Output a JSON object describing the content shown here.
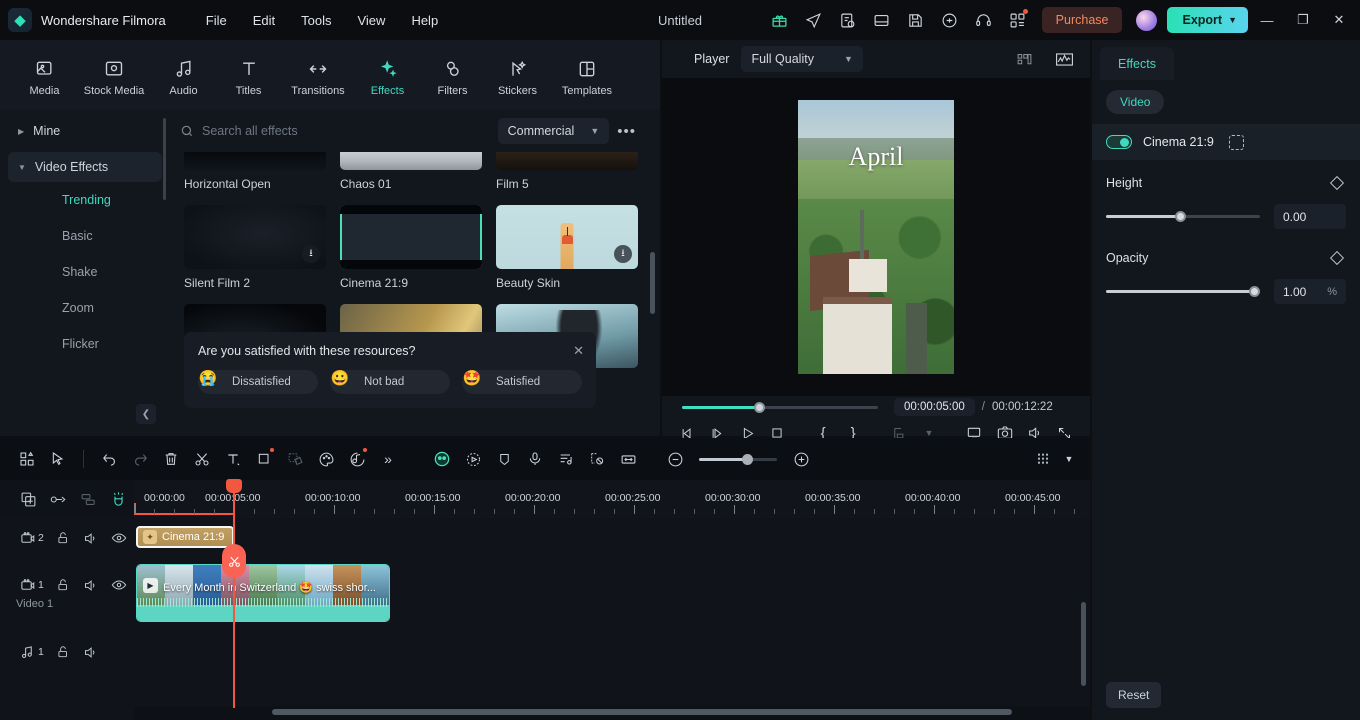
{
  "titlebar": {
    "brand": "Wondershare Filmora",
    "menus": [
      "File",
      "Edit",
      "Tools",
      "View",
      "Help"
    ],
    "doc_title": "Untitled",
    "icons": [
      "gift-icon",
      "send-icon",
      "tasklist-icon",
      "layout-icon",
      "save-icon",
      "cloud-icon",
      "headset-icon",
      "apps-icon"
    ],
    "purchase_label": "Purchase",
    "export_label": "Export",
    "accent_color": "#2ae0b4",
    "purchase_color": "#f0895f"
  },
  "modebar": {
    "items": [
      {
        "label": "Media",
        "icon": "media-icon"
      },
      {
        "label": "Stock Media",
        "icon": "stock-media-icon"
      },
      {
        "label": "Audio",
        "icon": "audio-icon"
      },
      {
        "label": "Titles",
        "icon": "titles-icon"
      },
      {
        "label": "Transitions",
        "icon": "transitions-icon"
      },
      {
        "label": "Effects",
        "icon": "effects-icon"
      },
      {
        "label": "Filters",
        "icon": "filters-icon"
      },
      {
        "label": "Stickers",
        "icon": "stickers-icon"
      },
      {
        "label": "Templates",
        "icon": "templates-icon"
      }
    ],
    "active": "Effects"
  },
  "search": {
    "placeholder": "Search all effects",
    "filter_label": "Commercial",
    "more_label": "•••"
  },
  "categories": {
    "mine": "Mine",
    "group": "Video Effects",
    "items": [
      "Trending",
      "Basic",
      "Shake",
      "Zoom",
      "Flicker"
    ],
    "active": "Trending"
  },
  "effects_grid": {
    "row_top": [
      "Horizontal Open",
      "Chaos 01",
      "Film 5"
    ],
    "row_main": [
      {
        "label": "Silent Film 2",
        "download": true,
        "selected": false
      },
      {
        "label": "Cinema 21:9",
        "download": false,
        "selected": true
      },
      {
        "label": "Beauty Skin",
        "download": true,
        "selected": false
      }
    ]
  },
  "feedback": {
    "question": "Are you satisfied with these resources?",
    "options": [
      {
        "label": "Dissatisfied",
        "emoji": "😭"
      },
      {
        "label": "Not bad",
        "emoji": "😀"
      },
      {
        "label": "Satisfied",
        "emoji": "🤩"
      }
    ]
  },
  "player": {
    "label": "Player",
    "quality": "Full Quality",
    "overlay_text": "April",
    "current_time": "00:00:05:00",
    "separator": "/",
    "total_time": "00:00:12:22",
    "controls": [
      "prev-frame-icon",
      "next-frame-icon",
      "play-icon",
      "stop-icon",
      "mark-in-icon",
      "mark-out-icon",
      "marker-icon",
      "chevron-down-icon",
      "screen-icon",
      "snapshot-icon",
      "volume-icon",
      "fullscreen-icon"
    ],
    "header_icons": [
      "grid-view-icon",
      "waveform-icon"
    ]
  },
  "right_panel": {
    "tab": "Effects",
    "chip": "Video",
    "effect_name": "Cinema 21:9",
    "effect_enabled": true,
    "properties": [
      {
        "name": "Height",
        "value": "0.00",
        "unit": "",
        "percent": 48
      },
      {
        "name": "Opacity",
        "value": "1.00",
        "unit": "%",
        "percent": 100
      }
    ],
    "reset_label": "Reset"
  },
  "timeline": {
    "toolbar_left": [
      "template-icon",
      "select-icon",
      "undo-icon",
      "redo-icon",
      "delete-icon",
      "split-icon",
      "text-icon",
      "crop-icon",
      "mask-icon",
      "color-icon",
      "ai-audio-icon",
      "more-icon"
    ],
    "toolbar_right": [
      "smart-cutout-icon",
      "motion-tracking-icon",
      "keyframe-icon",
      "voiceover-icon",
      "beat-detect-icon",
      "green-screen-icon",
      "fit-icon"
    ],
    "zoom_out": "−",
    "zoom_in": "+",
    "grid_icon": "grid-icon",
    "head_icons": [
      "add-media-icon",
      "link-icon",
      "group-icon",
      "magnet-icon"
    ],
    "ruler_labels": [
      "00:00:00",
      "00:00:05:00",
      "00:00:10:00",
      "00:00:15:00",
      "00:00:20:00",
      "00:00:25:00",
      "00:00:30:00",
      "00:00:35:00",
      "00:00:40:00",
      "00:00:45:00"
    ],
    "tracks": [
      {
        "num": "2",
        "type": "video",
        "label": "",
        "clip": "Cinema 21:9"
      },
      {
        "num": "1",
        "type": "video",
        "label": "Video 1",
        "clip": "Every Month in Switzerland 🤩 swiss shor..."
      },
      {
        "num": "1",
        "type": "audio",
        "label": "",
        "clip": ""
      }
    ],
    "playhead_time": "00:00:05:00"
  }
}
